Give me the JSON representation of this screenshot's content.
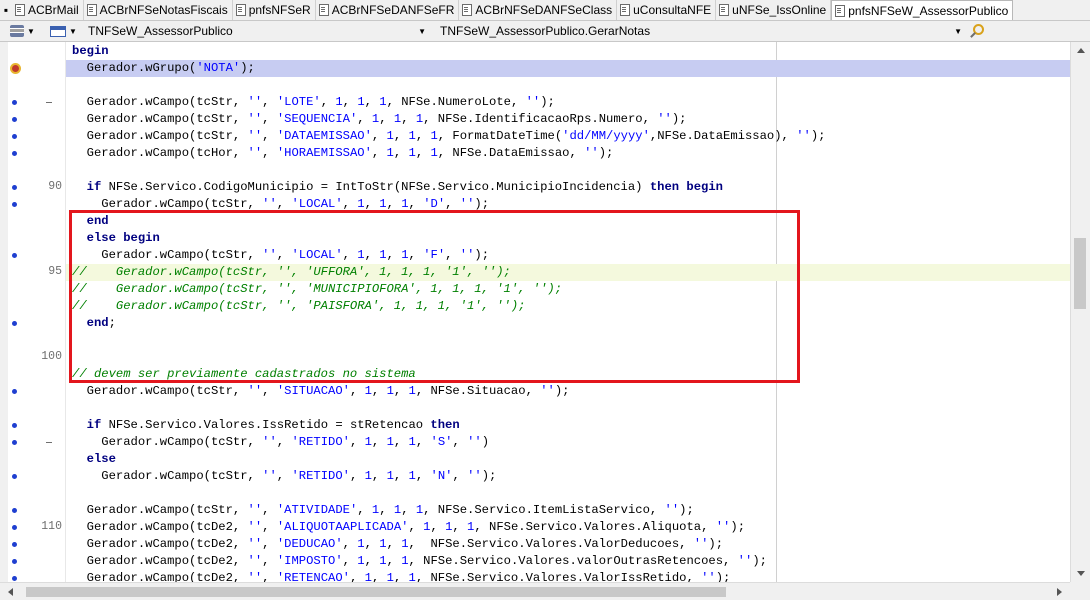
{
  "tabs": [
    {
      "label": "ACBrMail",
      "active": false
    },
    {
      "label": "ACBrNFSeNotasFiscais",
      "active": false
    },
    {
      "label": "pnfsNFSeR",
      "active": false
    },
    {
      "label": "ACBrNFSeDANFSeFR",
      "active": false
    },
    {
      "label": "ACBrNFSeDANFSeClass",
      "active": false
    },
    {
      "label": "uConsultaNFE",
      "active": false
    },
    {
      "label": "uNFSe_IssOnline",
      "active": false
    },
    {
      "label": "pnfsNFSeW_AssessorPublico",
      "active": true
    }
  ],
  "navigator": {
    "class_combo": "TNFSeW_AssessorPublico",
    "method_combo": "TNFSeW_AssessorPublico.GerarNotas"
  },
  "line_numbers": [
    "90",
    "95",
    "100",
    "110"
  ],
  "code_lines": [
    {
      "text": "begin",
      "marker": "none"
    },
    {
      "text": "  Gerador.wGrupo('NOTA');",
      "marker": "bp"
    },
    {
      "text": "",
      "marker": "none"
    },
    {
      "text": "  Gerador.wCampo(tcStr, '', 'LOTE', 1, 1, 1, NFSe.NumeroLote, '');",
      "marker": "dot-dash"
    },
    {
      "text": "  Gerador.wCampo(tcStr, '', 'SEQUENCIA', 1, 1, 1, NFSe.IdentificacaoRps.Numero, '');",
      "marker": "dot"
    },
    {
      "text": "  Gerador.wCampo(tcStr, '', 'DATAEMISSAO', 1, 1, 1, FormatDateTime('dd/MM/yyyy',NFSe.DataEmissao), '');",
      "marker": "dot"
    },
    {
      "text": "  Gerador.wCampo(tcHor, '', 'HORAEMISSAO', 1, 1, 1, NFSe.DataEmissao, '');",
      "marker": "dot"
    },
    {
      "text": "",
      "marker": "none"
    },
    {
      "text": "  if NFSe.Servico.CodigoMunicipio = IntToStr(NFSe.Servico.MunicipioIncidencia) then begin",
      "marker": "dot"
    },
    {
      "text": "    Gerador.wCampo(tcStr, '', 'LOCAL', 1, 1, 1, 'D', '');",
      "marker": "dot"
    },
    {
      "text": "  end",
      "marker": "none"
    },
    {
      "text": "  else begin",
      "marker": "none"
    },
    {
      "text": "    Gerador.wCampo(tcStr, '', 'LOCAL', 1, 1, 1, 'F', '');",
      "marker": "dot"
    },
    {
      "text": "//    Gerador.wCampo(tcStr, '', 'UFFORA', 1, 1, 1, '1', '');",
      "marker": "none"
    },
    {
      "text": "//    Gerador.wCampo(tcStr, '', 'MUNICIPIOFORA', 1, 1, 1, '1', '');",
      "marker": "none"
    },
    {
      "text": "//    Gerador.wCampo(tcStr, '', 'PAISFORA', 1, 1, 1, '1', '');",
      "marker": "none"
    },
    {
      "text": "  end;",
      "marker": "dot"
    },
    {
      "text": "",
      "marker": "none"
    },
    {
      "text": "",
      "marker": "none"
    },
    {
      "text": "// devem ser previamente cadastrados no sistema",
      "marker": "none"
    },
    {
      "text": "  Gerador.wCampo(tcStr, '', 'SITUACAO', 1, 1, 1, NFSe.Situacao, '');",
      "marker": "dot"
    },
    {
      "text": "",
      "marker": "none"
    },
    {
      "text": "  if NFSe.Servico.Valores.IssRetido = stRetencao then",
      "marker": "dot"
    },
    {
      "text": "    Gerador.wCampo(tcStr, '', 'RETIDO', 1, 1, 1, 'S', '')",
      "marker": "dot-dash"
    },
    {
      "text": "  else",
      "marker": "none"
    },
    {
      "text": "    Gerador.wCampo(tcStr, '', 'RETIDO', 1, 1, 1, 'N', '');",
      "marker": "dot"
    },
    {
      "text": "",
      "marker": "none"
    },
    {
      "text": "  Gerador.wCampo(tcStr, '', 'ATIVIDADE', 1, 1, 1, NFSe.Servico.ItemListaServico, '');",
      "marker": "dot"
    },
    {
      "text": "  Gerador.wCampo(tcDe2, '', 'ALIQUOTAAPLICADA', 1, 1, 1, NFSe.Servico.Valores.Aliquota, '');",
      "marker": "dot"
    },
    {
      "text": "  Gerador.wCampo(tcDe2, '', 'DEDUCAO', 1, 1, 1,  NFSe.Servico.Valores.ValorDeducoes, '');",
      "marker": "dot"
    },
    {
      "text": "  Gerador.wCampo(tcDe2, '', 'IMPOSTO', 1, 1, 1, NFSe.Servico.Valores.valorOutrasRetencoes, '');",
      "marker": "dot"
    },
    {
      "text": "  Gerador.wCampo(tcDe2, '', 'RETENCAO', 1, 1, 1, NFSe.Servico.Valores.ValorIssRetido, '');",
      "marker": "dot"
    }
  ],
  "colors": {
    "keyword": "#000080",
    "string": "#0000ff",
    "comment": "#008000",
    "exec_line": "#c7ccf2",
    "current_line": "#f4f9dd",
    "highlight_box": "#e3161d"
  }
}
